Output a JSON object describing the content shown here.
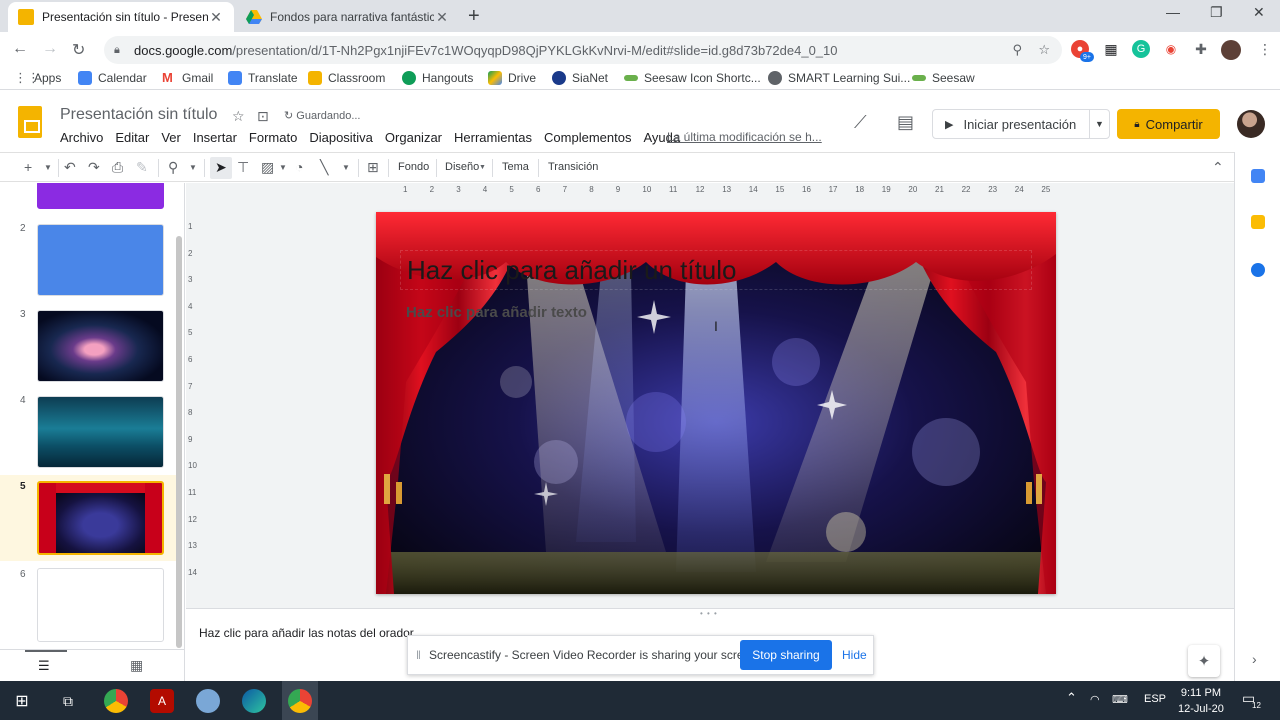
{
  "browser": {
    "tabs": [
      {
        "title": "Presentación sin título - Presenta",
        "active": true
      },
      {
        "title": "Fondos para narrativa fantástica -",
        "active": false
      }
    ],
    "url_host": "docs.google.com",
    "url_path": "/presentation/d/1T-Nh2Pgx1njiFEv7c1WOqyqpD98QjPYKLGkKvNrvi-M/edit#slide=id.g8d73b72de4_0_10",
    "ext_badge": "9+",
    "bookmarks": [
      {
        "label": "Apps",
        "color": "#5f6368"
      },
      {
        "label": "Calendar",
        "color": "#4285f4"
      },
      {
        "label": "Gmail",
        "color": "#ea4335"
      },
      {
        "label": "Translate",
        "color": "#4285f4"
      },
      {
        "label": "Classroom",
        "color": "#f4b400"
      },
      {
        "label": "Hangouts",
        "color": "#0f9d58"
      },
      {
        "label": "Drive",
        "color": "#fbbc04"
      },
      {
        "label": "SiaNet",
        "color": "#1a3a8a"
      },
      {
        "label": "Seesaw Icon Shortc...",
        "color": "#6ab04c"
      },
      {
        "label": "SMART Learning Sui...",
        "color": "#5f6368"
      },
      {
        "label": "Seesaw",
        "color": "#6ab04c"
      }
    ]
  },
  "app": {
    "doc_title": "Presentación sin título",
    "saving_status": "Guardando...",
    "menus": [
      "Archivo",
      "Editar",
      "Ver",
      "Insertar",
      "Formato",
      "Diapositiva",
      "Organizar",
      "Herramientas",
      "Complementos",
      "Ayuda"
    ],
    "last_modified": "La última modificación se h...",
    "present_label": "Iniciar presentación",
    "share_label": "Compartir",
    "accent": "#f4b400"
  },
  "edit_toolbar": {
    "background_label": "Fondo",
    "layout_label": "Diseño",
    "theme_label": "Tema",
    "transition_label": "Transición"
  },
  "filmstrip": {
    "slides": [
      {
        "num": "2"
      },
      {
        "num": "3"
      },
      {
        "num": "4"
      },
      {
        "num": "5"
      },
      {
        "num": "6"
      }
    ]
  },
  "ruler": {
    "h_ticks": [
      "1",
      "2",
      "3",
      "4",
      "5",
      "6",
      "7",
      "8",
      "9",
      "10",
      "11",
      "12",
      "13",
      "14",
      "15",
      "16",
      "17",
      "18",
      "19",
      "20",
      "21",
      "22",
      "23",
      "24",
      "25"
    ],
    "v_ticks": [
      "1",
      "2",
      "3",
      "4",
      "5",
      "6",
      "7",
      "8",
      "9",
      "10",
      "11",
      "12",
      "13",
      "14"
    ]
  },
  "slide": {
    "title_placeholder": "Haz clic para añadir un título",
    "body_placeholder": "Haz clic para añadir texto"
  },
  "notes": {
    "placeholder": "Haz clic para añadir las notas del orador"
  },
  "screencastify": {
    "message": "Screencastify - Screen Video Recorder is sharing your screen.",
    "stop_label": "Stop sharing",
    "hide_label": "Hide"
  },
  "taskbar": {
    "language": "ESP",
    "time": "9:11 PM",
    "date": "12-Jul-20",
    "notifications": "12"
  }
}
